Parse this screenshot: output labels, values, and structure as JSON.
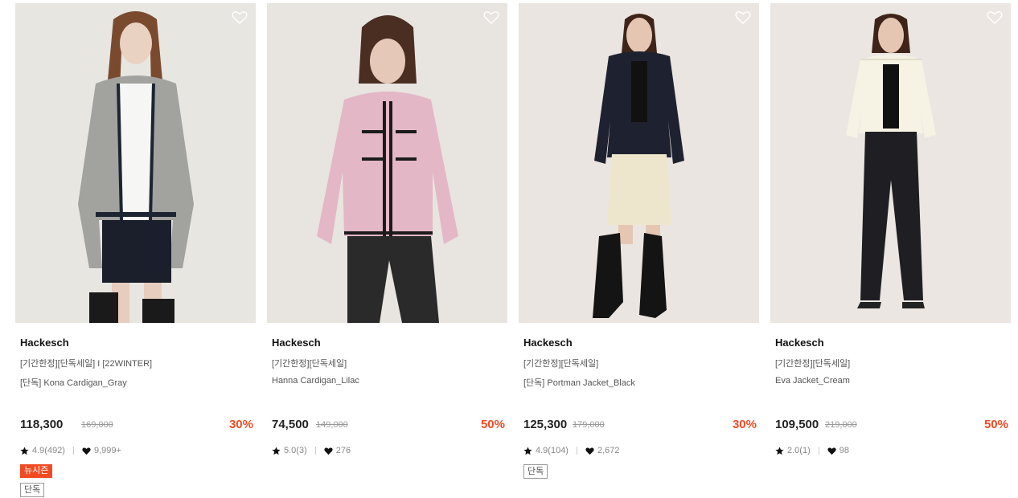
{
  "products": [
    {
      "brand": "Hackesch",
      "subtitle": "[기간한정][단독세일] I [22WINTER]",
      "name": "[단독] Kona Cardigan_Gray",
      "price": "118,300",
      "original_price": "169,000",
      "discount": "30%",
      "rating": "4.9(492)",
      "likes": "9,999+",
      "badges": {
        "new": "뉴시즌",
        "exclusive": "단독"
      },
      "image": {
        "bg": "#e7e6e1",
        "garment": "#a2a29f",
        "trim": "#1d2533",
        "inner": "#f6f6f4",
        "bottom": "#1b1f2b"
      }
    },
    {
      "brand": "Hackesch",
      "subtitle": "[기간한정][단독세일]",
      "name": "Hanna Cardigan_Lilac",
      "price": "74,500",
      "original_price": "149,000",
      "discount": "50%",
      "rating": "5.0(3)",
      "likes": "276",
      "badges": {},
      "image": {
        "bg": "#e8e4e0",
        "garment": "#e4b7c7",
        "trim": "#1b1b1b",
        "inner": "#e4b7c7",
        "bottom": "#2a2a2a"
      }
    },
    {
      "brand": "Hackesch",
      "subtitle": "[기간한정][단독세일]",
      "name": "[단독] Portman Jacket_Black",
      "price": "125,300",
      "original_price": "179,000",
      "discount": "30%",
      "rating": "4.9(104)",
      "likes": "2,672",
      "badges": {
        "exclusive": "단독"
      },
      "image": {
        "bg": "#ebe5e1",
        "garment": "#1e2230",
        "trim": "#0f1118",
        "inner": "#111111",
        "bottom": "#eee6cc"
      }
    },
    {
      "brand": "Hackesch",
      "subtitle": "[기간한정][단독세일]",
      "name": "Eva Jacket_Cream",
      "price": "109,500",
      "original_price": "219,000",
      "discount": "50%",
      "rating": "2.0(1)",
      "likes": "98",
      "badges": {},
      "image": {
        "bg": "#ebe6e2",
        "garment": "#f6f2e4",
        "trim": "#e2dccb",
        "inner": "#111111",
        "bottom": "#1f1f23"
      }
    }
  ],
  "colors": {
    "accent": "#f04b23",
    "text": "#111111",
    "muted": "#888888"
  },
  "icons": {
    "wishlist": "heart-outline-icon",
    "rating": "star-icon",
    "likes": "heart-icon"
  }
}
